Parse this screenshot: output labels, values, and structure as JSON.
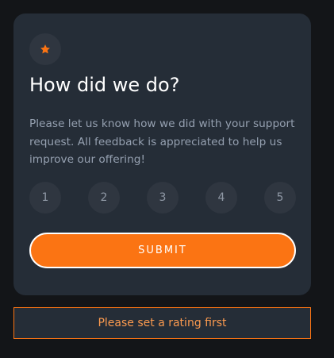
{
  "colors": {
    "background": "#131518",
    "card": "#252d37",
    "accent": "#fb7413",
    "muted_text": "#95a0b0"
  },
  "card": {
    "icon": "star-icon",
    "title": "How did we do?",
    "description": "Please let us know how we did with your support request. All feedback is appreciated to help us improve our offering!",
    "ratings": [
      "1",
      "2",
      "3",
      "4",
      "5"
    ],
    "submit_label": "SUBMIT"
  },
  "notice": {
    "message": "Please set a rating first"
  }
}
